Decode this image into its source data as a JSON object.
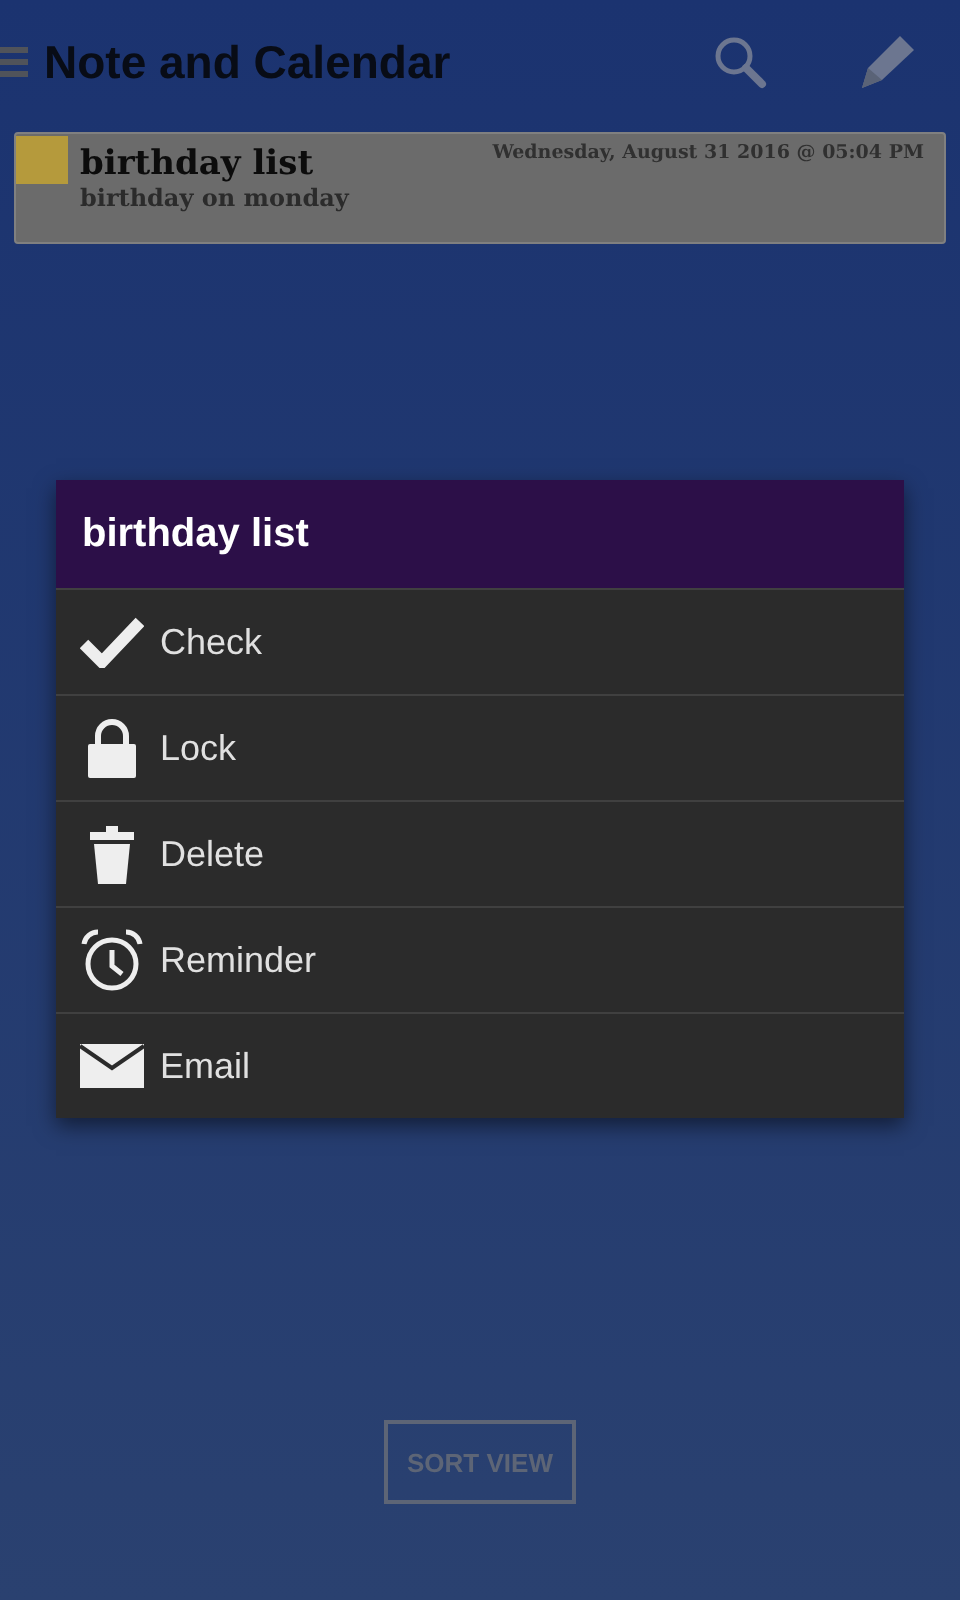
{
  "app_bar": {
    "title": "Note and Calendar"
  },
  "notes": [
    {
      "title": "birthday list",
      "subtitle": "birthday on monday",
      "date": "Wednesday, August 31 2016 @ 05:04 PM",
      "color": "#b59a3c"
    }
  ],
  "dialog": {
    "title": "birthday list",
    "items": [
      {
        "kind": "check",
        "label": "Check"
      },
      {
        "kind": "lock",
        "label": "Lock"
      },
      {
        "kind": "delete",
        "label": "Delete"
      },
      {
        "kind": "reminder",
        "label": "Reminder"
      },
      {
        "kind": "email",
        "label": "Email"
      }
    ]
  },
  "sort_button": "SORT VIEW"
}
